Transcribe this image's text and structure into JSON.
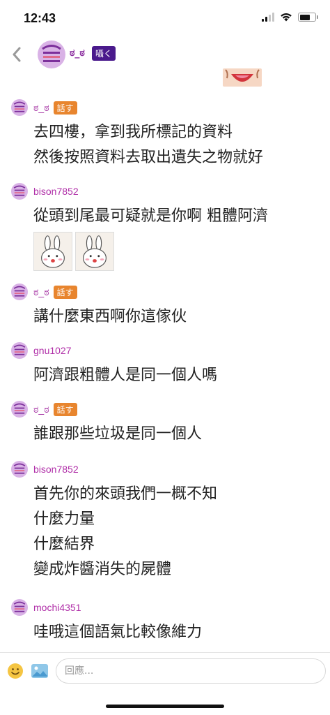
{
  "status_bar": {
    "time": "12:43"
  },
  "header": {
    "back_icon": "chevron-left-icon",
    "user_name": "ಠ_ಠ",
    "badge": "囁く"
  },
  "messages": [
    {
      "user": "ಠ_ಠ",
      "badge": "話す",
      "lines": [
        "去四樓，拿到我所標記的資料",
        "然後按照資料去取出遺失之物就好"
      ]
    },
    {
      "user": "bison7852",
      "badge": "",
      "lines": [
        "從頭到尾最可疑就是你啊 粗體阿濟"
      ],
      "stickers": 2
    },
    {
      "user": "ಠ_ಠ",
      "badge": "話す",
      "lines": [
        "講什麼東西啊你這傢伙"
      ]
    },
    {
      "user": "gnu1027",
      "badge": "",
      "lines": [
        "阿濟跟粗體人是同一個人嗎"
      ]
    },
    {
      "user": "ಠ_ಠ",
      "badge": "話す",
      "lines": [
        "誰跟那些垃圾是同一個人"
      ]
    },
    {
      "user": "bison7852",
      "badge": "",
      "lines": [
        "首先你的來頭我們一概不知",
        "什麼力量",
        "什麼結界",
        "變成炸醬消失的屍體"
      ]
    },
    {
      "user": "mochi4351",
      "badge": "",
      "lines": [
        "哇哦這個語氣比較像維力"
      ]
    }
  ],
  "composer": {
    "placeholder": "回應...",
    "emoji_icon": "emoji-icon",
    "image_icon": "image-icon"
  },
  "colors": {
    "username": "#a0289e",
    "speak_badge": "#e8852e",
    "whisper_badge": "#4a1a8c"
  }
}
